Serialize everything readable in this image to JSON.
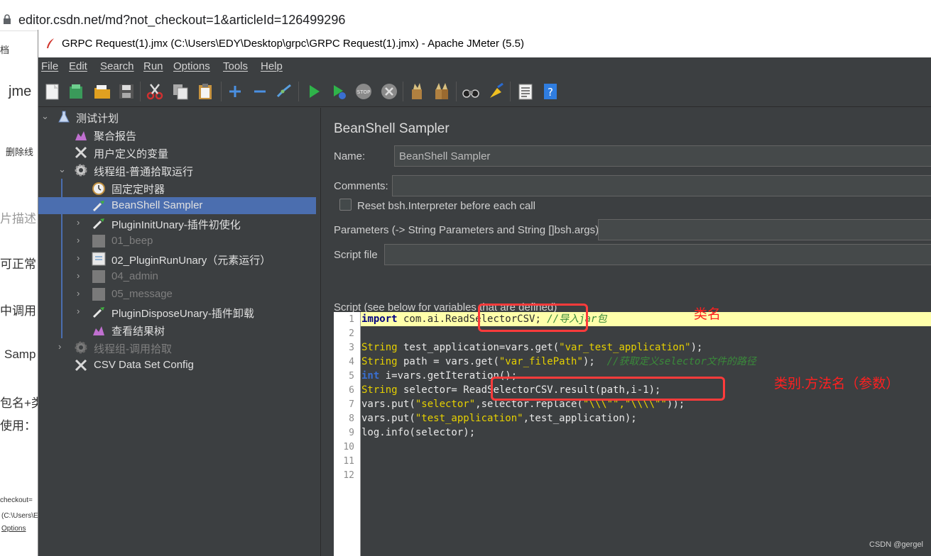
{
  "browser": {
    "url": "editor.csdn.net/md?not_checkout=1&articleId=126499296",
    "bg_texts": [
      "档",
      "jme",
      "删除线",
      "片描述",
      "可正常",
      "中调用",
      "Samp",
      "包名+类",
      "使用：",
      "checkout=",
      "(C:\\Users\\E",
      "Options"
    ]
  },
  "window": {
    "title": "GRPC Request(1).jmx (C:\\Users\\EDY\\Desktop\\grpc\\GRPC Request(1).jmx) - Apache JMeter (5.5)"
  },
  "menu": [
    "File",
    "Edit",
    "Search",
    "Run",
    "Options",
    "Tools",
    "Help"
  ],
  "tree": {
    "items": [
      {
        "label": "测试计划"
      },
      {
        "label": "聚合报告"
      },
      {
        "label": "用户定义的变量"
      },
      {
        "label": "线程组-普通拾取运行"
      },
      {
        "label": "固定定时器"
      },
      {
        "label": "BeanShell Sampler"
      },
      {
        "label": "PluginInitUnary-插件初使化"
      },
      {
        "label": "01_beep"
      },
      {
        "label": "02_PluginRunUnary（元素运行）"
      },
      {
        "label": "04_admin"
      },
      {
        "label": "05_message"
      },
      {
        "label": "PluginDisposeUnary-插件卸载"
      },
      {
        "label": "查看结果树"
      },
      {
        "label": "线程组-调用拾取"
      },
      {
        "label": "CSV Data Set Config"
      }
    ]
  },
  "panel": {
    "title": "BeanShell Sampler",
    "name_label": "Name:",
    "name_value": "BeanShell Sampler",
    "comments_label": "Comments:",
    "comments_value": "",
    "reset_label": "Reset bsh.Interpreter before each call",
    "params_label": "Parameters (-> String Parameters and String []bsh.args)",
    "params_value": "",
    "script_file_label": "Script file",
    "script_file_value": "",
    "script_label": "Script (see below for variables that are defined)"
  },
  "editor": {
    "line_numbers": [
      "1",
      "2",
      "3",
      "4",
      "5",
      "6",
      "7",
      "8",
      "9",
      "10",
      "11",
      "12"
    ],
    "code": {
      "l1_kw": "import",
      "l1_pkg": " com.ai.",
      "l1_cls": "ReadSelectorCSV;",
      "l1_comment": " //导入jar包",
      "l3_type": "String",
      "l3_rest1": " test_application=vars.get(",
      "l3_str": "\"var_test_application\"",
      "l3_rest2": ");",
      "l4_type": "String",
      "l4_rest1": " path = vars.get(",
      "l4_str": "\"var_filePath\"",
      "l4_rest2": ");  ",
      "l4_comment": "//获取定义selector文件的路径",
      "l5_type": "int",
      "l5_rest": " i=vars.getIteration();",
      "l6_type": "String",
      "l6_rest1": " selector= ",
      "l6_call": "ReadSelectorCSV.result(path,i-1);",
      "l7_rest1": "vars.put(",
      "l7_str": "\"selector\"",
      "l7_rest2": ",selector.replace(",
      "l7_str2": "\"\\\\\\\"\",\"\\\\\\\\\"\"",
      "l7_rest3": "));",
      "l8_rest1": "vars.put(",
      "l8_str": "\"test_application\"",
      "l8_rest2": ",test_application);",
      "l9_rest": "log.info(selector);"
    }
  },
  "annotations": {
    "class_name": "类名",
    "method_call": "类别.方法名（参数）"
  },
  "watermark": "CSDN @gergel",
  "colors": {
    "jmeter_bg": "#3c3f41",
    "selection": "#4b6eaf",
    "annotation": "#ff3b3b",
    "highlight_line": "#ffffaa"
  }
}
